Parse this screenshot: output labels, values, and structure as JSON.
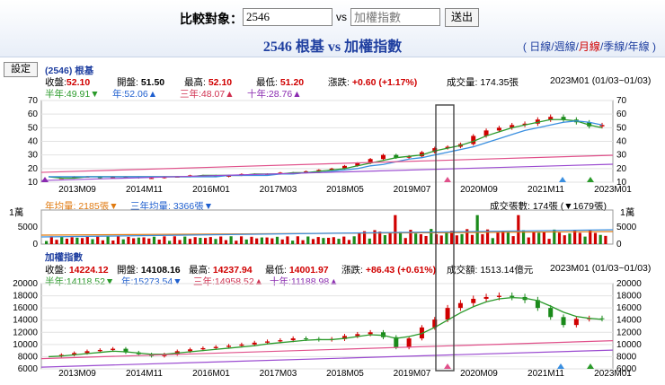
{
  "compare": {
    "label": "比較對象：",
    "input_value": "2546",
    "vs": "vs",
    "index_placeholder": "加權指數",
    "send_label": "送出"
  },
  "title": "2546 根基 vs 加權指數",
  "periods": {
    "open": "(",
    "items": [
      "日線",
      "週線",
      "月線",
      "季線",
      "年線"
    ],
    "close": ")",
    "active": "月線"
  },
  "setting_label": "設定",
  "stock": {
    "name": "(2546) 根基",
    "close_label": "收盤:",
    "close": "52.10",
    "open_label": "開盤:",
    "open": "51.50",
    "high_label": "最高:",
    "high": "52.10",
    "low_label": "最低:",
    "low": "51.20",
    "change_label": "漲跌:",
    "change": "+0.60",
    "change_pct": "(+1.17%)",
    "volume_label": "成交量:",
    "volume": "174.35張",
    "period": "2023M01 (01/03~01/03)",
    "ma_half": "半年:49.91▼",
    "ma_year": "年:52.06▲",
    "ma_3y": "三年:48.07▲",
    "ma_10y": "十年:28.76▲"
  },
  "volume": {
    "avg_year": "年均量: 2185張▼",
    "avg_3y": "三年均量: 3366張▼",
    "current": "成交張數: 174張 (▼1679張)",
    "unit": "1萬"
  },
  "index": {
    "name": "加權指數",
    "close_label": "收盤:",
    "close": "14224.12",
    "open_label": "開盤:",
    "open": "14108.16",
    "high_label": "最高:",
    "high": "14237.94",
    "low_label": "最低:",
    "low": "14001.97",
    "change_label": "漲跌:",
    "change": "+86.43",
    "change_pct": "(+0.61%)",
    "volume_label": "成交額:",
    "volume": "1513.14億元",
    "period": "2023M01 (01/03~01/03)",
    "ma_half": "半年:14118.52▼",
    "ma_year": "年:15273.54▼",
    "ma_3y": "三年:14958.52▲",
    "ma_10y": "十年:11188.98▲"
  },
  "colors": {
    "up": "#d00000",
    "down": "#1a8a1a",
    "ma_half": "#2a9a2a",
    "ma_year": "#3a8fe0",
    "ma_3y": "#e0508a",
    "ma_10y": "#9a4ad0"
  },
  "x_ticks": [
    "2013M09",
    "2014M11",
    "2016M01",
    "2017M03",
    "2018M05",
    "2019M07",
    "2020M09",
    "2021M11",
    "2023M01"
  ],
  "chart_data": [
    {
      "type": "line",
      "title": "(2546) 根基",
      "ylim": [
        10,
        70
      ],
      "yticks": [
        10,
        20,
        30,
        40,
        50,
        60,
        70
      ],
      "series": [
        {
          "name": "收盤",
          "values": [
            13,
            13,
            14,
            14,
            13,
            14,
            14,
            13,
            13,
            14,
            14,
            15,
            15,
            14,
            15,
            16,
            16,
            16,
            17,
            17,
            18,
            19,
            20,
            22,
            24,
            27,
            30,
            28,
            29,
            32,
            35,
            36,
            38,
            44,
            48,
            50,
            52,
            53,
            56,
            58,
            56,
            54,
            51,
            52
          ]
        },
        {
          "name": "半年",
          "values": [
            14,
            13,
            13,
            14,
            14,
            14,
            14,
            14,
            14,
            14,
            14,
            14,
            15,
            15,
            15,
            15,
            16,
            16,
            16,
            17,
            17,
            18,
            19,
            20,
            22,
            24,
            26,
            28,
            29,
            30,
            33,
            35,
            37,
            40,
            44,
            47,
            50,
            52,
            54,
            56,
            56,
            55,
            52,
            50
          ]
        },
        {
          "name": "年",
          "values": [
            14,
            14,
            14,
            14,
            14,
            14,
            14,
            14,
            14,
            14,
            14,
            14,
            14,
            14,
            15,
            15,
            15,
            15,
            16,
            16,
            17,
            17,
            18,
            19,
            20,
            22,
            23,
            25,
            27,
            28,
            30,
            32,
            34,
            36,
            39,
            42,
            45,
            48,
            50,
            52,
            54,
            55,
            54,
            52
          ]
        }
      ]
    },
    {
      "type": "line",
      "title": "加權指數",
      "ylim": [
        6000,
        20000
      ],
      "yticks": [
        6000,
        8000,
        10000,
        12000,
        14000,
        16000,
        18000,
        20000
      ],
      "series": [
        {
          "name": "收盤",
          "values": [
            8100,
            8300,
            8600,
            8900,
            9100,
            9300,
            8700,
            8400,
            8100,
            8400,
            8900,
            9200,
            9400,
            9600,
            9800,
            10000,
            10300,
            10500,
            10700,
            11000,
            10900,
            10800,
            10900,
            11400,
            11700,
            12000,
            11200,
            9500,
            11000,
            12800,
            14100,
            16000,
            16800,
            17500,
            17800,
            18000,
            17800,
            17300,
            16000,
            14500,
            13200,
            14200,
            14300,
            14224
          ]
        },
        {
          "name": "半年",
          "values": [
            8000,
            8100,
            8300,
            8500,
            8700,
            8900,
            8800,
            8600,
            8400,
            8400,
            8600,
            8800,
            9000,
            9200,
            9400,
            9600,
            9800,
            10100,
            10300,
            10500,
            10700,
            10800,
            10800,
            11000,
            11300,
            11600,
            11500,
            11000,
            11300,
            11800,
            12800,
            14000,
            15200,
            16200,
            17000,
            17500,
            17700,
            17600,
            17200,
            16300,
            15300,
            14600,
            14300,
            14118
          ]
        }
      ]
    }
  ]
}
